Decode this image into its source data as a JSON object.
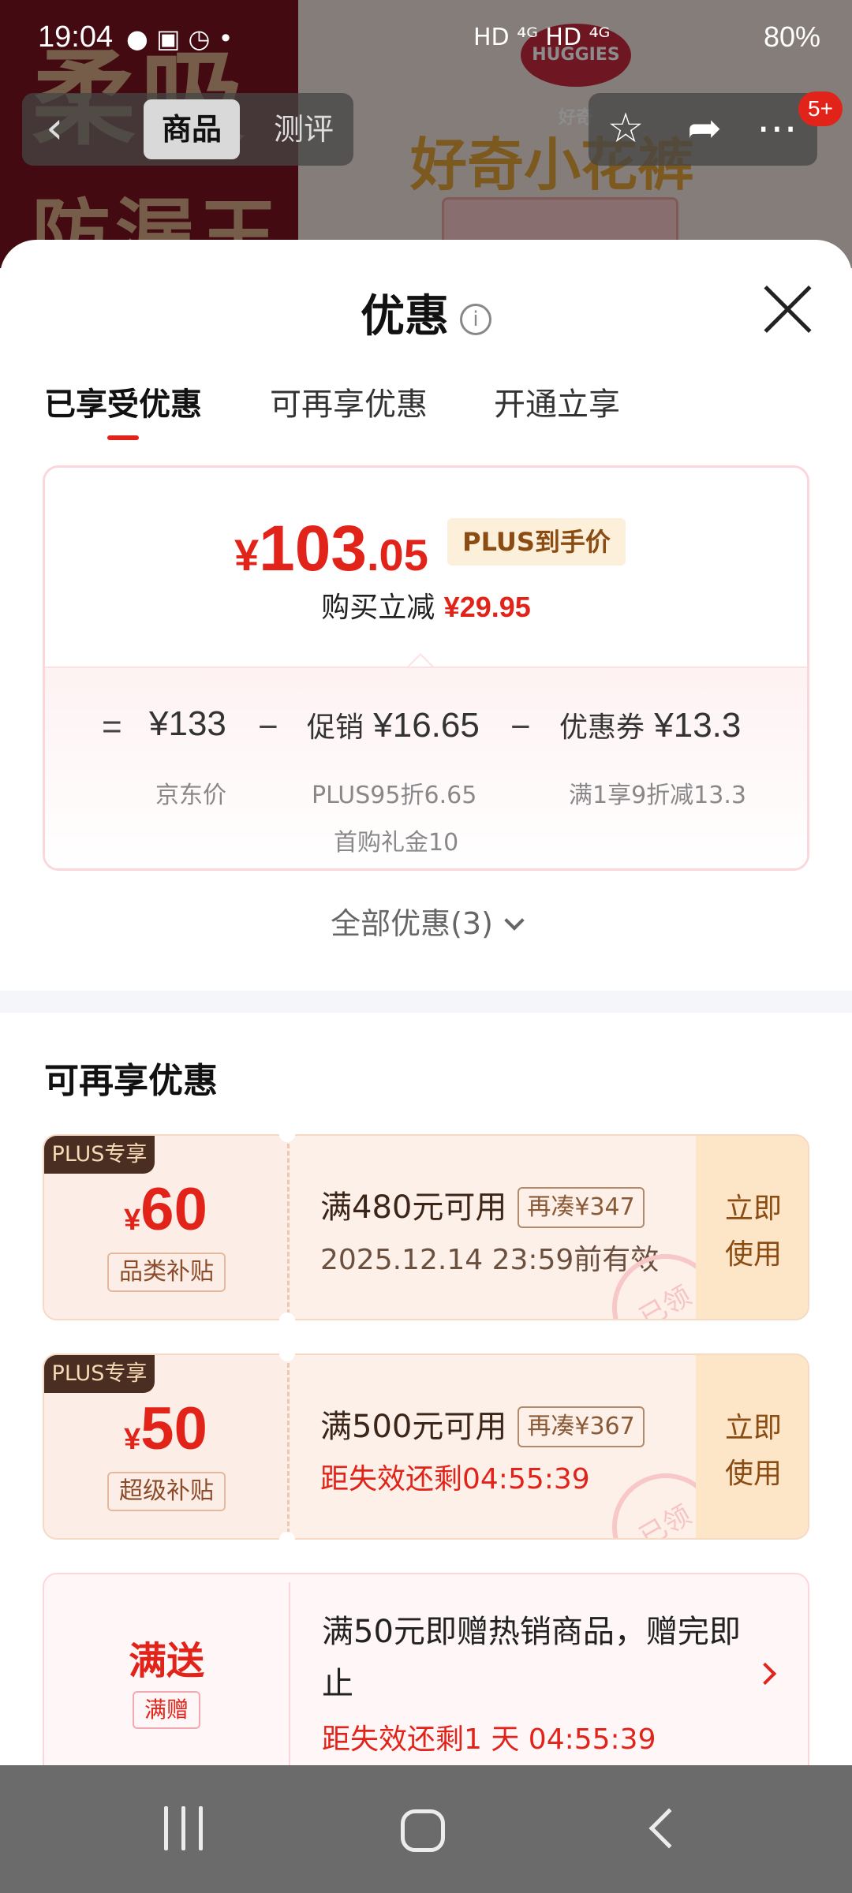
{
  "status_bar": {
    "time": "19:04",
    "left_icons": "● ▣ ◷ •",
    "right_icons": "HD ⁴ᴳ HD ⁴ᴳ",
    "battery": "80%"
  },
  "background_page": {
    "bg_text_1": "柔吸",
    "bg_text_2": "防漏王",
    "promo_text": "好奇小花裤",
    "brand_logo": "HUGGIES 好奇",
    "tabs": [
      "商品",
      "测评"
    ],
    "badge": "5+"
  },
  "sheet": {
    "title": "优惠",
    "info_icon": "i",
    "tabs": [
      "已享受优惠",
      "可再享优惠",
      "开通立享"
    ],
    "active_tab": 0
  },
  "price_card": {
    "currency": "¥",
    "price_int": "103",
    "price_dec": ".05",
    "plus_tag": "PLUS到手价",
    "reduce_label": "购买立减",
    "reduce_value": "¥29.95",
    "formula": {
      "eq": "=",
      "jd_price": "¥133",
      "jd_label": "京东价",
      "minus1": "−",
      "promo_label": "促销",
      "promo_value": "¥16.65",
      "promo_sub1": "PLUS95折6.65",
      "promo_sub2": "首购礼金10",
      "minus2": "−",
      "coupon_label": "优惠券",
      "coupon_value": "¥13.3",
      "coupon_sub": "满1享9折减13.3"
    }
  },
  "all_discounts": "全部优惠(3)",
  "more_section": {
    "title": "可再享优惠",
    "coupons": [
      {
        "tag": "PLUS专享",
        "currency": "¥",
        "amount": "60",
        "type": "品类补贴",
        "condition": "满480元可用",
        "extra": "再凑¥347",
        "validity": "2025.12.14 23:59前有效",
        "button": "立即使用",
        "stamp": "已领"
      },
      {
        "tag": "PLUS专享",
        "currency": "¥",
        "amount": "50",
        "type": "超级补贴",
        "condition": "满500元可用",
        "extra": "再凑¥367",
        "validity": "距失效还剩04:55:39",
        "button": "立即使用",
        "stamp": "已领"
      }
    ],
    "gift": {
      "main": "满送",
      "type": "满赠",
      "text": "满50元即赠热销商品，赠完即止",
      "time": "距失效还剩1 天 04:55:39"
    }
  }
}
